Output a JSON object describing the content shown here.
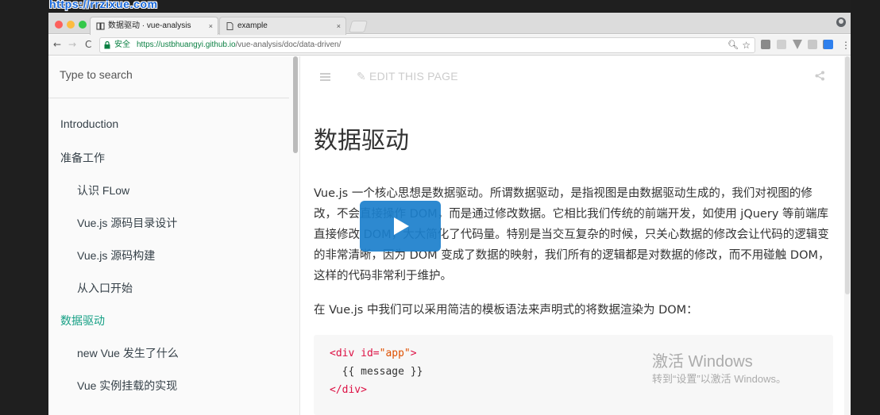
{
  "watermark": "https://rrzixue.com",
  "browser": {
    "tabs": [
      {
        "title": "数据驱动 · vue-analysis",
        "active": true
      },
      {
        "title": "example",
        "active": false
      }
    ],
    "close_glyph": "×",
    "address": {
      "secure_label": "安全",
      "url_prefix": "https://ustbhuangyi.github.io",
      "url_path": "/vue-analysis/doc/data-driven/"
    },
    "nav": {
      "back": "←",
      "forward": "→",
      "reload": "C"
    }
  },
  "sidebar": {
    "search_placeholder": "Type to search",
    "items": [
      {
        "label": "Introduction",
        "level": 1,
        "active": false
      },
      {
        "label": "准备工作",
        "level": 1,
        "active": false
      },
      {
        "label": "认识 FLow",
        "level": 2,
        "active": false
      },
      {
        "label": "Vue.js 源码目录设计",
        "level": 2,
        "active": false
      },
      {
        "label": "Vue.js 源码构建",
        "level": 2,
        "active": false
      },
      {
        "label": "从入口开始",
        "level": 2,
        "active": false
      },
      {
        "label": "数据驱动",
        "level": 1,
        "active": true
      },
      {
        "label": "new Vue 发生了什么",
        "level": 2,
        "active": false
      },
      {
        "label": "Vue 实例挂载的实现",
        "level": 2,
        "active": false
      }
    ],
    "accent": "#16a085"
  },
  "toolbar": {
    "edit_label": "EDIT THIS PAGE"
  },
  "article": {
    "title": "数据驱动",
    "para1": "Vue.js 一个核心思想是数据驱动。所谓数据驱动，是指视图是由数据驱动生成的，我们对视图的修改，不会直接操作 DOM，而是通过修改数据。它相比我们传统的前端开发，如使用 jQuery 等前端库直接修改 DOM，大大简化了代码量。特别是当交互复杂的时候，只关心数据的修改会让代码的逻辑变的非常清晰，因为 DOM 变成了数据的映射，我们所有的逻辑都是对数据的修改，而不用碰触 DOM，这样的代码非常利于维护。",
    "para2": "在 Vue.js 中我们可以采用简洁的模板语法来声明式的将数据渲染为 DOM：",
    "code": {
      "l1_open": "<div",
      "l1_attr": " id=",
      "l1_val": "\"app\"",
      "l1_close": ">",
      "l2": "  {{ message }}",
      "l3": "</div>"
    }
  },
  "overlay": {
    "windows_title": "激活 Windows",
    "windows_sub": "转到“设置”以激活 Windows。"
  }
}
